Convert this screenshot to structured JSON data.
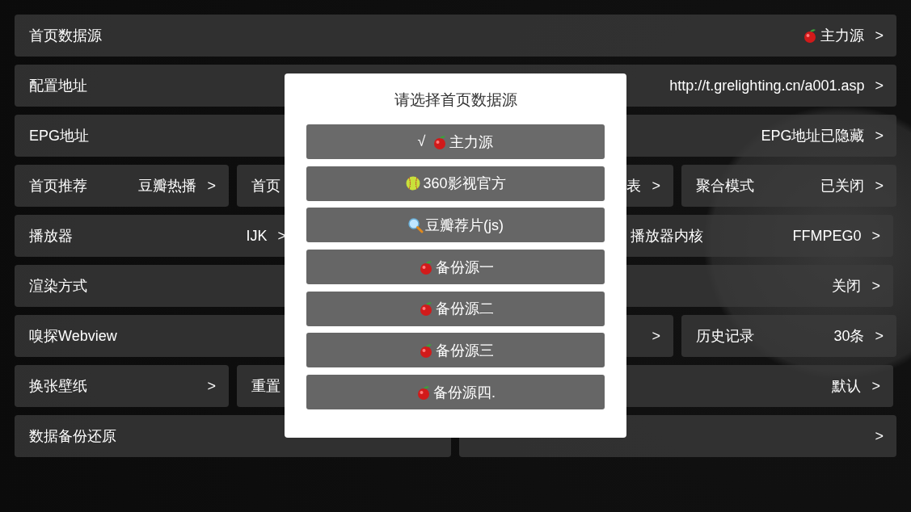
{
  "settings_rows": [
    {
      "cells": [
        {
          "label": "首页数据源",
          "kind": "apple",
          "value": "主力源",
          "arrow": ">"
        }
      ]
    },
    {
      "cells": [
        {
          "label": "配置地址",
          "value": "http://t.grelighting.cn/a001.asp",
          "arrow": ">"
        }
      ]
    },
    {
      "cells": [
        {
          "label": "EPG地址",
          "value": "EPG地址已隐藏",
          "arrow": ">"
        }
      ]
    },
    {
      "cells": [
        {
          "label": "首页推荐",
          "value": "豆瓣热播",
          "arrow": ">"
        },
        {
          "label": "首页",
          "value": "表",
          "arrow": ">"
        },
        {
          "label": "聚合模式",
          "value": "已关闭",
          "arrow": ">"
        }
      ]
    },
    {
      "cells": [
        {
          "label": "播放器",
          "value": "IJK",
          "arrow": ">"
        },
        {
          "label": "播放器内核",
          "value": "FFMPEG0",
          "arrow": ">"
        }
      ]
    },
    {
      "cells": [
        {
          "label": "渲染方式",
          "value": "关闭",
          "arrow": ">"
        }
      ]
    },
    {
      "cells": [
        {
          "label": "嗅探Webview",
          "arrow": ">"
        },
        {
          "label": "历史记录",
          "value": "30条",
          "arrow": ">"
        }
      ]
    },
    {
      "cells": [
        {
          "label": "换张壁纸",
          "arrow": ">"
        },
        {
          "label": "重置",
          "value": "默认",
          "arrow": ">"
        }
      ]
    },
    {
      "cells": [
        {
          "label": "数据备份还原"
        },
        {
          "arrow": ">"
        }
      ]
    }
  ],
  "dialog": {
    "title": "请选择首页数据源",
    "check_mark": "√",
    "options": [
      {
        "kind": "apple",
        "label": "主力源",
        "selected": true
      },
      {
        "kind": "softball",
        "label": "360影视官方",
        "selected": false
      },
      {
        "kind": "magnifier",
        "label": "豆瓣荐片(js)",
        "selected": false
      },
      {
        "kind": "apple",
        "label": "备份源一",
        "selected": false
      },
      {
        "kind": "apple",
        "label": "备份源二",
        "selected": false
      },
      {
        "kind": "apple",
        "label": "备份源三",
        "selected": false
      },
      {
        "kind": "apple",
        "label": "备份源四.",
        "selected": false
      }
    ]
  }
}
